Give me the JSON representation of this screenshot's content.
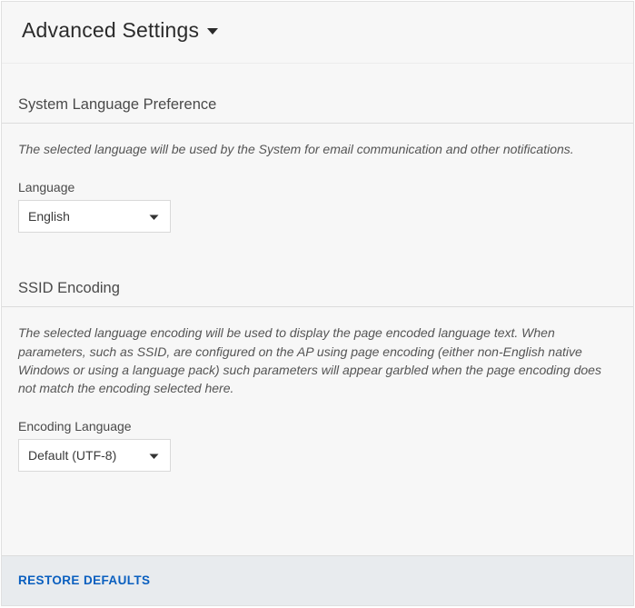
{
  "header": {
    "title": "Advanced Settings"
  },
  "sections": {
    "language": {
      "title": "System Language Preference",
      "description": "The selected language will be used by the System for email communication and other notifications.",
      "field_label": "Language",
      "selected": "English"
    },
    "encoding": {
      "title": "SSID Encoding",
      "description": "The selected language encoding will be used to display the page encoded language text. When parameters, such as SSID, are configured on the AP using page encoding (either non-English native Windows or using a language pack) such parameters will appear garbled when the page encoding does not match the encoding selected here.",
      "field_label": "Encoding Language",
      "selected": "Default (UTF-8)"
    }
  },
  "footer": {
    "restore_label": "RESTORE DEFAULTS"
  }
}
